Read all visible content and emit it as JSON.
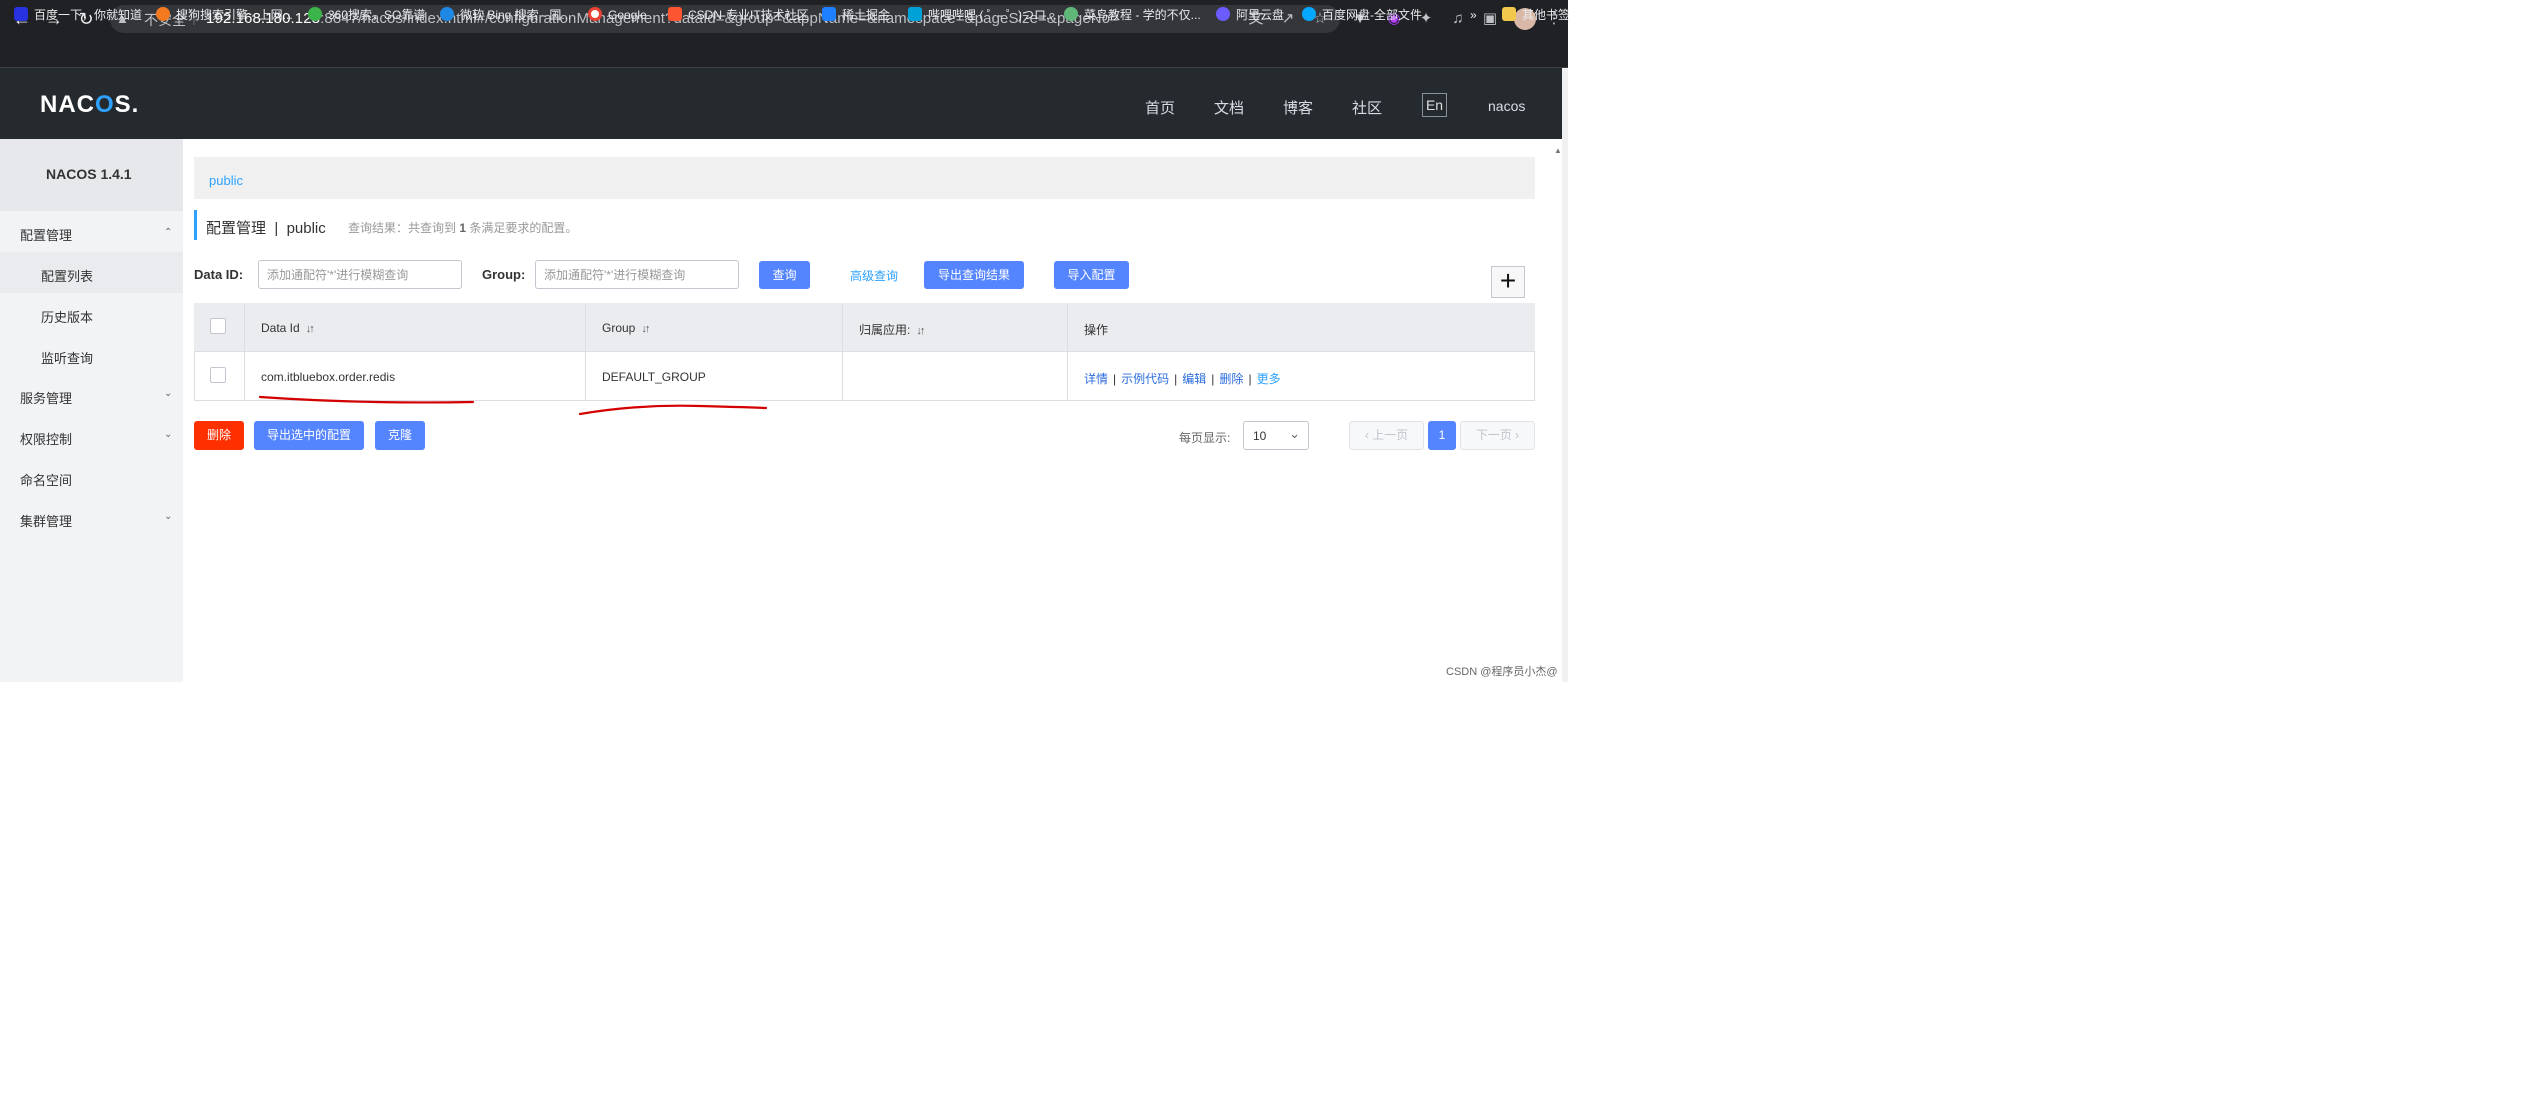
{
  "browser": {
    "insecure_label": "不安全",
    "url_host": "192.168.180.128",
    "url_rest": ":8847/nacos/index.html#/configurationManagement?dataId=&group=&appName=&namespace=&pageSize=&pageNo=",
    "bookmarks": [
      "百度一下，你就知道",
      "搜狗搜索引擎 - 上网...",
      "360搜索，SO靠谱",
      "微软 Bing 搜索 - 国...",
      "Google",
      "CSDN-专业IT技术社区",
      "稀土掘金",
      "哔哩哔哩 ( ゜- ゜)つロ...",
      "菜鸟教程 - 学的不仅...",
      "阿里云盘",
      "百度网盘-全部文件"
    ],
    "bookmarks_overflow": "»",
    "other_bookmarks": "其他书签"
  },
  "header": {
    "logo_pre": "NAC",
    "logo_o": "O",
    "logo_post": "S.",
    "nav": [
      "首页",
      "文档",
      "博客",
      "社区"
    ],
    "lang": "En",
    "user": "nacos"
  },
  "sidebar": {
    "brand": "NACOS 1.4.1",
    "config_mgmt": "配置管理",
    "config_list": "配置列表",
    "history": "历史版本",
    "listen": "监听查询",
    "service_mgmt": "服务管理",
    "auth": "权限控制",
    "namespace": "命名空间",
    "cluster": "集群管理"
  },
  "main": {
    "breadcrumb": "public",
    "title": "配置管理  |  public",
    "result_pre": "查询结果：共查询到 ",
    "result_count": "1",
    "result_post": " 条满足要求的配置。",
    "dataid_label": "Data ID:",
    "dataid_placeholder": "添加通配符'*'进行模糊查询",
    "group_label": "Group:",
    "group_placeholder": "添加通配符'*'进行模糊查询",
    "query_btn": "查询",
    "advanced_query": "高级查询",
    "export_query_btn": "导出查询结果",
    "import_btn": "导入配置",
    "add_btn": "+"
  },
  "table": {
    "headers": [
      "Data Id",
      "Group",
      "归属应用:",
      "操作"
    ],
    "sort_glyph": "↓↑",
    "rows": [
      {
        "data_id": "com.itbluebox.order.redis",
        "group": "DEFAULT_GROUP",
        "app": ""
      }
    ],
    "ops": [
      "详情",
      "示例代码",
      "编辑",
      "删除",
      "更多"
    ],
    "op_sep": "|"
  },
  "footer": {
    "delete_btn": "删除",
    "export_selected_btn": "导出选中的配置",
    "clone_btn": "克隆",
    "page_size_label": "每页显示:",
    "page_size": "10",
    "prev": "上一页",
    "current_page": "1",
    "next": "下一页"
  },
  "watermark": "CSDN @程序员小杰@",
  "colors": {
    "accent": "#5584ff",
    "link": "#2ea1ff",
    "danger": "#ff3000",
    "annotation_stroke": "#d40000",
    "header_bg": "#252a2f"
  }
}
